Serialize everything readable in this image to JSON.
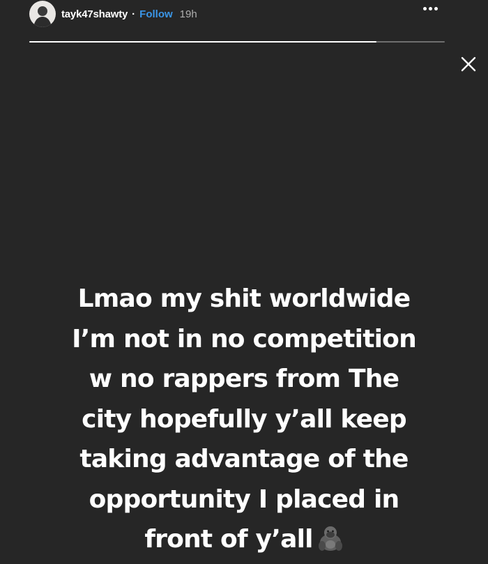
{
  "header": {
    "username": "tayk47shawty",
    "separator": "·",
    "follow_label": "Follow",
    "time": "19h"
  },
  "progress": {
    "fraction": 0.835
  },
  "icons": {
    "avatar": "avatar",
    "more": "more-options-icon",
    "close": "close-icon",
    "gorilla": "gorilla-emoji-icon"
  },
  "caption": {
    "lines": [
      "Lmao my shit worldwide",
      "I’m not in no competition",
      "w no rappers from The",
      "city hopefully y’all keep",
      "taking advantage of the",
      "opportunity I placed in",
      "front of y’all"
    ]
  },
  "colors": {
    "background": "#262626",
    "follow": "#3b96e8",
    "text": "#ffffff"
  }
}
